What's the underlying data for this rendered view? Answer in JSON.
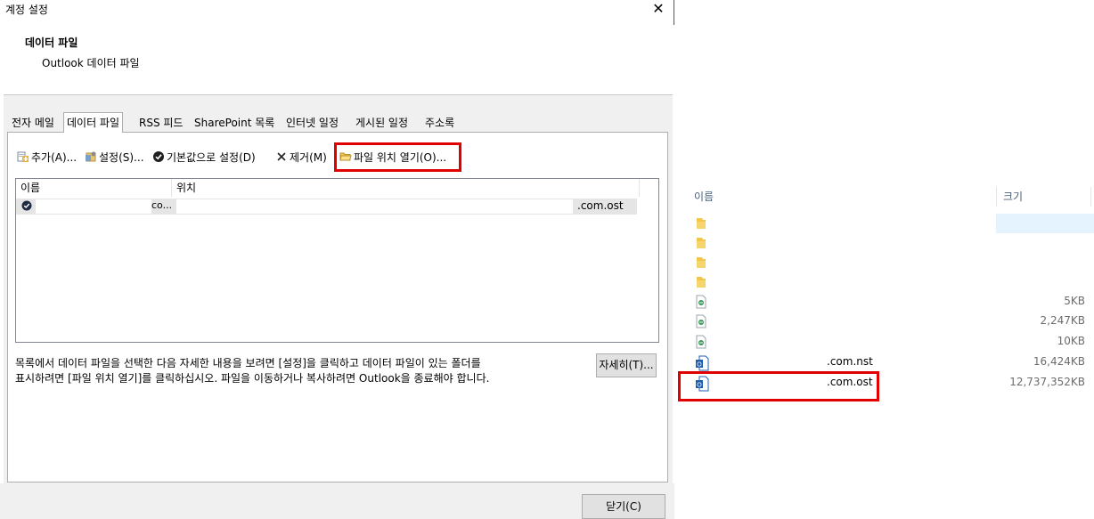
{
  "dialog": {
    "title": "계정 설정",
    "close_glyph": "✕",
    "header_title": "데이터 파일",
    "header_subtitle": "Outlook 데이터 파일",
    "tabs": [
      {
        "label": "전자 메일"
      },
      {
        "label": "데이터 파일",
        "active": true
      },
      {
        "label": "RSS 피드"
      },
      {
        "label": "SharePoint 목록"
      },
      {
        "label": "인터넷 일정"
      },
      {
        "label": "게시된 일정"
      },
      {
        "label": "주소록"
      }
    ],
    "toolbar": {
      "add": "추가(A)...",
      "settings": "설정(S)...",
      "default": "기본값으로 설정(D)",
      "remove": "제거(M)",
      "open_location": "파일 위치 열기(O)..."
    },
    "list": {
      "col_name": "이름",
      "col_location": "위치",
      "rows": [
        {
          "name": "co...",
          "location": ".com.ost"
        }
      ]
    },
    "description_line1": "목록에서 데이터 파일을 선택한 다음 자세한 내용을 보려면 [설정]을 클릭하고 데이터 파일이 있는 폴더를",
    "description_line2": "표시하려면 [파일 위치 열기]를 클릭하십시오. 파일을 이동하거나 복사하려면 Outlook을 종료해야 합니다.",
    "details_button": "자세히(T)...",
    "close_button": "닫기(C)"
  },
  "explorer": {
    "col_name": "이름",
    "col_size": "크기",
    "rows": [
      {
        "icon": "folder-icon",
        "name": "",
        "size": ""
      },
      {
        "icon": "folder-icon",
        "name": "",
        "size": ""
      },
      {
        "icon": "folder-icon",
        "name": "",
        "size": ""
      },
      {
        "icon": "folder-icon",
        "name": "",
        "size": ""
      },
      {
        "icon": "config-file-icon",
        "name": "",
        "size": "5KB"
      },
      {
        "icon": "config-file-icon",
        "name": "",
        "size": "2,247KB"
      },
      {
        "icon": "config-file-icon",
        "name": "",
        "size": "10KB"
      },
      {
        "icon": "outlook-file-icon",
        "name": ".com.nst",
        "size": "16,424KB"
      },
      {
        "icon": "outlook-file-icon",
        "name": ".com.ost",
        "size": "12,737,352KB"
      }
    ]
  },
  "colors": {
    "highlight": "#e00000",
    "dialog_bg": "#f0f0f0",
    "list_selection": "#e5e5e5",
    "explorer_selection": "#e5f3ff"
  }
}
